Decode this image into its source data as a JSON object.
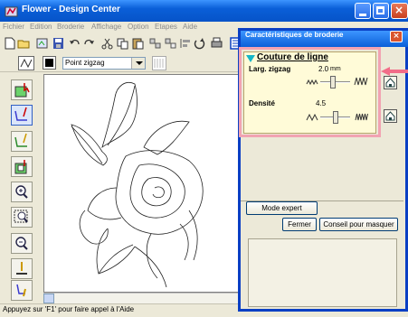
{
  "window": {
    "title": "Flower - Design Center"
  },
  "menu": [
    "Fichier",
    "Edition",
    "Broderie",
    "Affichage",
    "Option",
    "Etapes",
    "Aide"
  ],
  "toolbar2": {
    "stitch_select": "Point zigzag"
  },
  "status": {
    "text": "Appuyez sur 'F1' pour faire appel à l'Aide"
  },
  "panel": {
    "title": "Caractéristiques de broderie",
    "section_title": "Couture de ligne",
    "fields": [
      {
        "label": "Larg. zigzag",
        "value": "2.0",
        "unit": "mm"
      },
      {
        "label": "Densité",
        "value": "4.5",
        "unit": ""
      }
    ],
    "mode_expert": "Mode expert",
    "fermer": "Fermer",
    "conseil": "Conseil pour masquer"
  },
  "colors": {
    "accent": "#0a5fd8",
    "highlight": "#f2a3b2",
    "arrow": "#f26d88",
    "inner_bg": "#fffbd8"
  }
}
